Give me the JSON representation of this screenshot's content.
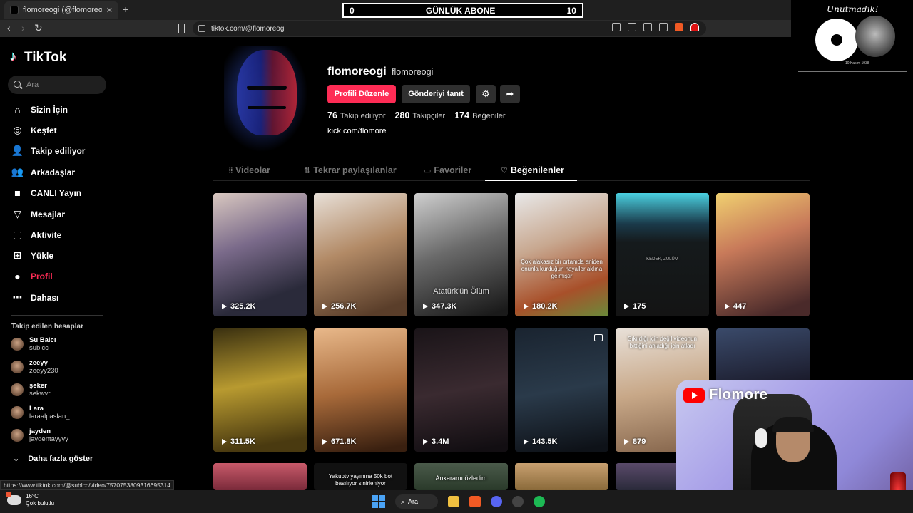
{
  "browser": {
    "tab_title": "flomoreogi (@flomoreogi) | TikT",
    "url": "tiktok.com/@flomoreogi",
    "status_url": "https://www.tiktok.com/@sublcc/video/7570753809316695314"
  },
  "overlay": {
    "counter_left": "0",
    "counter_title": "GÜNLÜK ABONE",
    "counter_right": "10",
    "brand_tagline": "Unutmadık!",
    "brand_date": "10 Kasım 1938",
    "webcam_name": "Flomore"
  },
  "sidebar": {
    "logo": "TikTok",
    "search_placeholder": "Ara",
    "nav": [
      {
        "label": "Sizin İçin",
        "icon": "home-icon"
      },
      {
        "label": "Keşfet",
        "icon": "compass-icon"
      },
      {
        "label": "Takip ediliyor",
        "icon": "following-icon"
      },
      {
        "label": "Arkadaşlar",
        "icon": "friends-icon"
      },
      {
        "label": "CANLI Yayın",
        "icon": "live-icon"
      },
      {
        "label": "Mesajlar",
        "icon": "message-icon"
      },
      {
        "label": "Aktivite",
        "icon": "activity-icon"
      },
      {
        "label": "Yükle",
        "icon": "upload-icon"
      },
      {
        "label": "Profil",
        "icon": "profile-icon"
      },
      {
        "label": "Dahası",
        "icon": "more-icon"
      }
    ],
    "following_title": "Takip edilen hesaplar",
    "following": [
      {
        "name": "Su Balcı",
        "handle": "sublcc"
      },
      {
        "name": "zeeyy",
        "handle": "zeeyy230"
      },
      {
        "name": "şeker",
        "handle": "sekwvr"
      },
      {
        "name": "Lara",
        "handle": "laraalpaslan_"
      },
      {
        "name": "jayden",
        "handle": "jaydentayyyy"
      }
    ],
    "show_more": "Daha fazla göster"
  },
  "profile": {
    "username": "flomoreogi",
    "nickname": "flomoreogi",
    "edit_button": "Profili Düzenle",
    "promote_button": "Gönderiyi tanıt",
    "following_count": "76",
    "following_label": "Takip ediliyor",
    "followers_count": "280",
    "followers_label": "Takipçiler",
    "likes_count": "174",
    "likes_label": "Beğeniler",
    "link": "kick.com/flomore"
  },
  "tabs": [
    "Videolar",
    "Tekrar paylaşılanlar",
    "Favoriler",
    "Beğenilenler"
  ],
  "videos": [
    {
      "views": "325.2K",
      "caption": ""
    },
    {
      "views": "256.7K",
      "caption": ""
    },
    {
      "views": "347.3K",
      "caption": "Atatürk'ün Ölüm"
    },
    {
      "views": "180.2K",
      "caption": "Çok alakasız bir ortamda aniden onunla kurduğun hayaller aklına gelmiştir"
    },
    {
      "views": "175",
      "caption": "KEDER, ZULÜM"
    },
    {
      "views": "447",
      "caption": ""
    },
    {
      "views": "311.5K",
      "caption": ""
    },
    {
      "views": "671.8K",
      "caption": ""
    },
    {
      "views": "3.4M",
      "caption": ""
    },
    {
      "views": "143.5K",
      "caption": ""
    },
    {
      "views": "879",
      "caption": "Sıkıldığı için değil videonun bittiğini anladığı için atladı"
    },
    {
      "views": "",
      "caption": ""
    },
    {
      "views": "",
      "caption": ""
    },
    {
      "views": "",
      "caption": "Yakuptv yayınına 50k bot basılıyor sinirleniyor"
    },
    {
      "views": "",
      "caption": "Ankaramı özledim"
    },
    {
      "views": "",
      "caption": ""
    },
    {
      "views": "",
      "caption": ""
    }
  ],
  "taskbar": {
    "temperature": "16°C",
    "weather": "Çok bulutlu",
    "search": "Ara"
  },
  "colors": {
    "accent": "#fe2c55",
    "background": "#000000"
  }
}
